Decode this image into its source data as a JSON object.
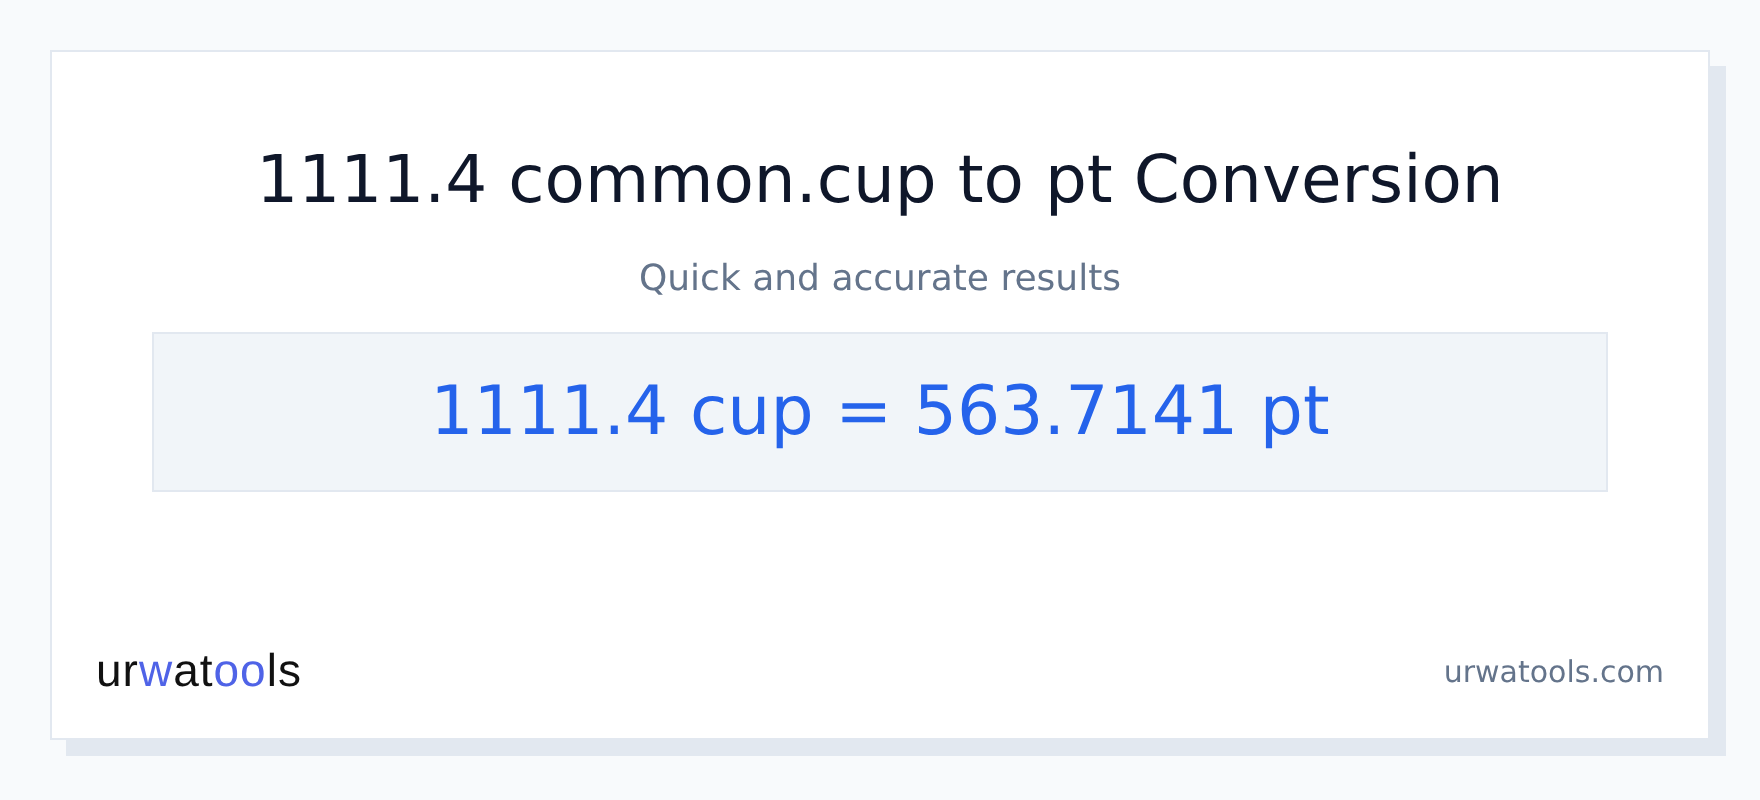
{
  "title": "1111.4 common.cup to pt Conversion",
  "subtitle": "Quick and accurate results",
  "result": "1111.4 cup = 563.7141 pt",
  "logo": [
    {
      "text": "ur",
      "accent": false
    },
    {
      "text": "w",
      "accent": true
    },
    {
      "text": "at",
      "accent": false
    },
    {
      "text": "oo",
      "accent": true
    },
    {
      "text": "ls",
      "accent": false
    }
  ],
  "site": "urwatools.com"
}
